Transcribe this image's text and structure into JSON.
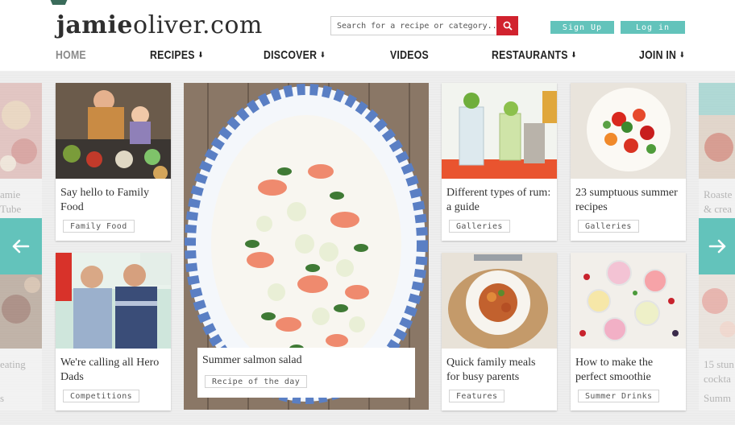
{
  "header": {
    "logo_bold": "jamie",
    "logo_rest": "oliver.com",
    "search_placeholder": "Search for a recipe or category..",
    "signup_label": "Sign Up",
    "login_label": "Log in"
  },
  "nav": [
    {
      "label": "HOME",
      "caret": ""
    },
    {
      "label": "RECIPES",
      "caret": "⬇"
    },
    {
      "label": "DISCOVER",
      "caret": "⬇"
    },
    {
      "label": "VIDEOS",
      "caret": ""
    },
    {
      "label": "RESTAURANTS",
      "caret": "⬇"
    },
    {
      "label": "JOIN IN",
      "caret": "⬇"
    }
  ],
  "cards": [
    {
      "title": "Say hello to Family Food",
      "tag": "Family Food"
    },
    {
      "title": "We're calling all Hero Dads",
      "tag": "Competitions"
    },
    {
      "title": "Different types of rum: a guide",
      "tag": "Galleries"
    },
    {
      "title": "23 sumptuous summer recipes",
      "tag": "Galleries"
    },
    {
      "title": "Quick family meals for busy parents",
      "tag": "Features"
    },
    {
      "title": "How to make the perfect smoothie",
      "tag": "Summer Drinks"
    }
  ],
  "feature": {
    "title": "Summer salmon salad",
    "tag": "Recipe of the day"
  },
  "side_left": {
    "line1": "amie",
    "line2": "Tube",
    "line3": "eating",
    "line4": "s"
  },
  "side_right": {
    "line1": "Roaste",
    "line2": "& crea",
    "line3": "15 stun",
    "line4": "cockta",
    "line5": "Summ"
  },
  "colors": {
    "accent": "#63c3bb",
    "search_button": "#d1222e",
    "logo_text": "#2f2f2f"
  },
  "icons": {
    "search": "search-icon",
    "prev": "arrow-left-icon",
    "next": "arrow-right-icon"
  }
}
